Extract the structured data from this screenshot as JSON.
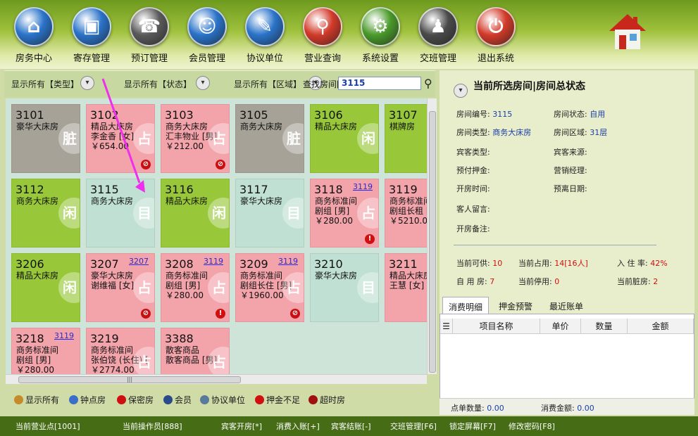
{
  "nav": [
    {
      "label": "房务中心",
      "icon": "house-icon",
      "color": "#2a73c9",
      "glyph": "⌂"
    },
    {
      "label": "寄存管理",
      "icon": "bag-icon",
      "color": "#2a73c9",
      "glyph": "▣"
    },
    {
      "label": "预订管理",
      "icon": "phone-icon",
      "color": "#5a5a5a",
      "glyph": "☎"
    },
    {
      "label": "会员管理",
      "icon": "person-icon",
      "color": "#2a73c9",
      "glyph": "☺"
    },
    {
      "label": "协议单位",
      "icon": "document-icon",
      "color": "#2a73c9",
      "glyph": "✎"
    },
    {
      "label": "营业查询",
      "icon": "magnifier-icon",
      "color": "#d23a2a",
      "glyph": "⚲"
    },
    {
      "label": "系统设置",
      "icon": "gear-icon",
      "color": "#4a9a2a",
      "glyph": "⚙"
    },
    {
      "label": "交班管理",
      "icon": "meeting-icon",
      "color": "#4a4a4a",
      "glyph": "♟"
    },
    {
      "label": "退出系统",
      "icon": "power-icon",
      "color": "#d23a2a",
      "glyph": "⏻"
    }
  ],
  "filters": {
    "type_label": "显示所有【类型】",
    "status_label": "显示所有【状态】",
    "area_label": "显示所有【区域】",
    "query_label": "查找房间[F3]:",
    "query_value": "3115"
  },
  "rooms": [
    {
      "no": "3101",
      "lines": [
        "豪华大床房"
      ],
      "color": "gray",
      "stat": "脏",
      "link": "",
      "badge": ""
    },
    {
      "no": "3102",
      "lines": [
        "精品大床房",
        "李金香 [女]",
        "￥654.00"
      ],
      "color": "pink",
      "stat": "占",
      "link": "",
      "badge": "no"
    },
    {
      "no": "3103",
      "lines": [
        "商务大床房",
        "汇丰物业 [男]",
        "￥212.00"
      ],
      "color": "pink",
      "stat": "占",
      "link": "",
      "badge": "no"
    },
    {
      "no": "3105",
      "lines": [
        "商务大床房"
      ],
      "color": "gray",
      "stat": "脏",
      "link": "",
      "badge": ""
    },
    {
      "no": "3106",
      "lines": [
        "精品大床房"
      ],
      "color": "green",
      "stat": "闲",
      "link": "",
      "badge": ""
    },
    {
      "no": "3107",
      "lines": [
        "棋牌房"
      ],
      "color": "green",
      "stat": "",
      "link": "",
      "badge": ""
    },
    {
      "no": "3112",
      "lines": [
        "商务大床房"
      ],
      "color": "green",
      "stat": "闲",
      "link": "",
      "badge": ""
    },
    {
      "no": "3115",
      "lines": [
        "商务大床房"
      ],
      "color": "mint",
      "stat": "目",
      "link": "",
      "badge": ""
    },
    {
      "no": "3116",
      "lines": [
        "精品大床房"
      ],
      "color": "green",
      "stat": "闲",
      "link": "",
      "badge": ""
    },
    {
      "no": "3117",
      "lines": [
        "豪华大床房"
      ],
      "color": "mint",
      "stat": "目",
      "link": "",
      "badge": ""
    },
    {
      "no": "3118",
      "lines": [
        "商务标准间",
        "剧组 [男]",
        "￥280.00"
      ],
      "color": "pink",
      "stat": "占",
      "link": "3119",
      "badge": "warn"
    },
    {
      "no": "3119",
      "lines": [
        "商务标准间",
        "剧组长租 [",
        "￥5210.00"
      ],
      "color": "pink",
      "stat": "",
      "link": "",
      "badge": ""
    },
    {
      "no": "3206",
      "lines": [
        "精品大床房"
      ],
      "color": "green",
      "stat": "闲",
      "link": "",
      "badge": ""
    },
    {
      "no": "3207",
      "lines": [
        "豪华大床房",
        "谢维福 [女]"
      ],
      "color": "pink",
      "stat": "占",
      "link": "3207",
      "badge": "no"
    },
    {
      "no": "3208",
      "lines": [
        "商务标准间",
        "剧组 [男]",
        "￥280.00"
      ],
      "color": "pink",
      "stat": "占",
      "link": "3119",
      "badge": "warn"
    },
    {
      "no": "3209",
      "lines": [
        "商务标准间",
        "剧组长住 [男]",
        "￥1960.00"
      ],
      "color": "pink",
      "stat": "占",
      "link": "3119",
      "badge": "no"
    },
    {
      "no": "3210",
      "lines": [
        "豪华大床房"
      ],
      "color": "mint",
      "stat": "目",
      "link": "",
      "badge": ""
    },
    {
      "no": "3211",
      "lines": [
        "精品大床房",
        "王慧 [女]"
      ],
      "color": "pink",
      "stat": "",
      "link": "",
      "badge": ""
    },
    {
      "no": "3218",
      "lines": [
        "商务标准间",
        "剧组 [男]",
        "￥280.00"
      ],
      "color": "pink",
      "stat": "",
      "link": "3119",
      "badge": ""
    },
    {
      "no": "3219",
      "lines": [
        "商务标准间",
        "张伯饶 (长住) [",
        "￥2774.00"
      ],
      "color": "pink",
      "stat": "占",
      "link": "",
      "badge": ""
    },
    {
      "no": "3388",
      "lines": [
        "散客商品",
        "散客商品 [男]"
      ],
      "color": "pink",
      "stat": "占",
      "link": "",
      "badge": ""
    }
  ],
  "legend": [
    {
      "label": "显示所有",
      "icon": "all-rooms-icon",
      "color": "#c58a2a"
    },
    {
      "label": "钟点房",
      "icon": "clock-icon",
      "color": "#3a6ec9"
    },
    {
      "label": "保密房",
      "icon": "no-entry-icon",
      "color": "#d01010"
    },
    {
      "label": "会员",
      "icon": "member-icon",
      "color": "#2a4a8a"
    },
    {
      "label": "协议单位",
      "icon": "agreement-icon",
      "color": "#5a7a9a"
    },
    {
      "label": "押金不足",
      "icon": "warning-icon",
      "color": "#d01010"
    },
    {
      "label": "超时房",
      "icon": "overtime-icon",
      "color": "#a01010"
    }
  ],
  "panel": {
    "title": "当前所选房间|房间总状态",
    "room_no_label": "房间编号:",
    "room_no": "3115",
    "room_status_label": "房间状态:",
    "room_status": "自用",
    "room_type_label": "房间类型:",
    "room_type": "商务大床房",
    "room_area_label": "房间区域:",
    "room_area": "31层",
    "guest_type_label": "宾客类型:",
    "guest_source_label": "宾客来源:",
    "deposit_label": "预付押金:",
    "manager_label": "营销经理:",
    "open_time_label": "开房时间:",
    "leave_date_label": "预离日期:",
    "message_label": "客人留言:",
    "remark_label": "开房备注:",
    "available_label": "当前可供:",
    "available": "10",
    "occupied_label": "当前占用:",
    "occupied": "14[16人]",
    "occupancy_label": "入 住 率:",
    "occupancy": "42%",
    "selfuse_label": "自 用 房:",
    "selfuse": "7",
    "stopped_label": "当前停用:",
    "stopped": "0",
    "dirty_label": "当前脏房:",
    "dirty": "2"
  },
  "tabs": [
    "消费明细",
    "押金预警",
    "最近账单"
  ],
  "table_headers": [
    "项目名称",
    "单价",
    "数量",
    "金额"
  ],
  "footer_stats": {
    "count_label": "点单数量:",
    "count": "0.00",
    "amount_label": "消费金额:",
    "amount": "0.00"
  },
  "status_bar": [
    "当前营业点[1001]",
    "当前操作员[888]",
    "宾客开房[*]",
    "消费入账[+]",
    "宾客结账[-]",
    "交班管理[F6]",
    "锁定屏幕[F7]",
    "修改密码[F8]"
  ]
}
